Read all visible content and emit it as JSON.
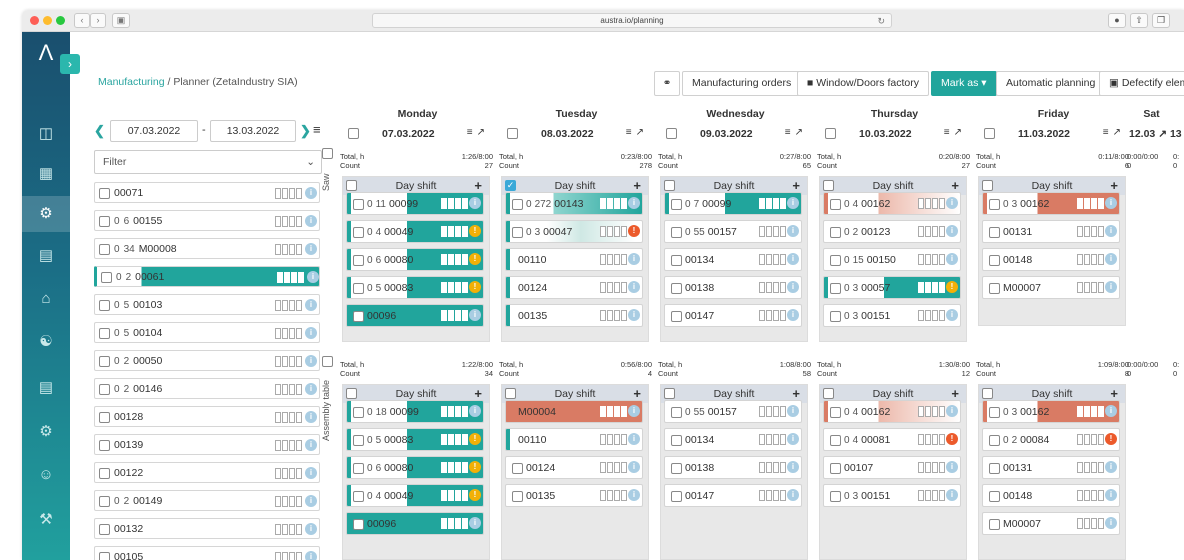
{
  "browser": {
    "url": "austra.io/planning"
  },
  "breadcrumb": {
    "root": "Manufacturing",
    "sep": "/",
    "current": "Planner (ZetaIndustry SIA)"
  },
  "toolbar": {
    "manufacturing_orders": "Manufacturing orders",
    "factory": "Window/Doors factory",
    "mark_as": "Mark as",
    "automatic_planning": "Automatic planning",
    "defectify": "Defectify eleme"
  },
  "date_range": {
    "from": "07.03.2022",
    "sep": "-",
    "to": "13.03.2022"
  },
  "filter": {
    "placeholder": "Filter"
  },
  "groups": {
    "saw": "Saw",
    "assembly": "Assembly table"
  },
  "left_list": [
    {
      "n1": "",
      "n2": "",
      "code": "00071",
      "ind": "n"
    },
    {
      "n1": "0",
      "n2": "6",
      "code": "00155",
      "ind": "n"
    },
    {
      "n1": "0",
      "n2": "34",
      "code": "M00008",
      "ind": "n"
    },
    {
      "n1": "0",
      "n2": "2",
      "code": "00061",
      "ind": "n"
    },
    {
      "n1": "0",
      "n2": "5",
      "code": "00103",
      "ind": "n"
    },
    {
      "n1": "0",
      "n2": "5",
      "code": "00104",
      "ind": "n"
    },
    {
      "n1": "0",
      "n2": "2",
      "code": "00050",
      "ind": "n"
    },
    {
      "n1": "0",
      "n2": "2",
      "code": "00146",
      "ind": "n"
    },
    {
      "n1": "",
      "n2": "",
      "code": "00128",
      "ind": "n"
    },
    {
      "n1": "",
      "n2": "",
      "code": "00139",
      "ind": "n"
    },
    {
      "n1": "",
      "n2": "",
      "code": "00122",
      "ind": "n"
    },
    {
      "n1": "0",
      "n2": "2",
      "code": "00149",
      "ind": "n"
    },
    {
      "n1": "",
      "n2": "",
      "code": "00132",
      "ind": "n"
    },
    {
      "n1": "",
      "n2": "",
      "code": "00105",
      "ind": "n"
    }
  ],
  "days": [
    {
      "name": "Monday",
      "date": "07.03.2022",
      "saw": {
        "total_label": "Total, h",
        "total": "1:26/8:00",
        "count_label": "Count",
        "count": "27"
      },
      "asm": {
        "total_label": "Total, h",
        "total": "1:22/8:00",
        "count_label": "Count",
        "count": "34"
      }
    },
    {
      "name": "Tuesday",
      "date": "08.03.2022",
      "saw": {
        "total_label": "Total, h",
        "total": "0:23/8:00",
        "count_label": "Count",
        "count": "278"
      },
      "asm": {
        "total_label": "Total, h",
        "total": "0:56/8:00",
        "count_label": "Count",
        "count": "4"
      }
    },
    {
      "name": "Wednesday",
      "date": "09.03.2022",
      "saw": {
        "total_label": "Total, h",
        "total": "0:27/8:00",
        "count_label": "Count",
        "count": "65"
      },
      "asm": {
        "total_label": "Total, h",
        "total": "1:08/8:00",
        "count_label": "Count",
        "count": "58"
      }
    },
    {
      "name": "Thursday",
      "date": "10.03.2022",
      "saw": {
        "total_label": "Total, h",
        "total": "0:20/8:00",
        "count_label": "Count",
        "count": "27"
      },
      "asm": {
        "total_label": "Total, h",
        "total": "1:30/8:00",
        "count_label": "Count",
        "count": "12"
      }
    },
    {
      "name": "Friday",
      "date": "11.03.2022",
      "saw": {
        "total_label": "Total, h",
        "total": "0:11/8:00",
        "count_label": "Count",
        "count": "6"
      },
      "asm": {
        "total_label": "Total, h",
        "total": "1:09/8:00",
        "count_label": "Count",
        "count": "8"
      }
    }
  ],
  "saturday": {
    "name": "Sat",
    "date": "12.03",
    "date2": "13",
    "saw_total": "0:00/0:00",
    "saw_short": "0:",
    "saw_count": "0",
    "saw_count2": "0",
    "asm_total": "0:00/0:00",
    "asm_short": "0:",
    "asm_count": "0",
    "asm_count2": "0"
  },
  "shift_label": "Day shift",
  "saw_cards": [
    [
      {
        "n1": "0",
        "n2": "11",
        "code": "00099",
        "style": "teal",
        "ind": "n"
      },
      {
        "n1": "0",
        "n2": "4",
        "code": "00049",
        "style": "teal",
        "ind": "warn"
      },
      {
        "n1": "0",
        "n2": "6",
        "code": "00080",
        "style": "teal",
        "ind": "warn"
      },
      {
        "n1": "0",
        "n2": "5",
        "code": "00083",
        "style": "teal",
        "ind": "warn"
      },
      {
        "n1": "",
        "n2": "",
        "code": "00096",
        "style": "tealfull",
        "ind": "n"
      }
    ],
    [
      {
        "n1": "0",
        "n2": "272",
        "code": "00143",
        "style": "tealfade",
        "ind": "n"
      },
      {
        "n1": "0",
        "n2": "3",
        "code": "00047",
        "style": "tealfade2",
        "ind": "err"
      },
      {
        "n1": "",
        "n2": "",
        "code": "00110",
        "style": "stripe",
        "ind": "n"
      },
      {
        "n1": "",
        "n2": "",
        "code": "00124",
        "style": "stripe",
        "ind": "n"
      },
      {
        "n1": "",
        "n2": "",
        "code": "00135",
        "style": "stripe",
        "ind": "n"
      }
    ],
    [
      {
        "n1": "0",
        "n2": "7",
        "code": "00099",
        "style": "teal",
        "ind": "n"
      },
      {
        "n1": "0",
        "n2": "55",
        "code": "00157",
        "style": "plain",
        "ind": "n"
      },
      {
        "n1": "",
        "n2": "",
        "code": "00134",
        "style": "plain",
        "ind": "n"
      },
      {
        "n1": "",
        "n2": "",
        "code": "00138",
        "style": "plain",
        "ind": "n"
      },
      {
        "n1": "",
        "n2": "",
        "code": "00147",
        "style": "plain",
        "ind": "n"
      }
    ],
    [
      {
        "n1": "0",
        "n2": "4",
        "code": "00162",
        "style": "redfade",
        "ind": "n"
      },
      {
        "n1": "0",
        "n2": "2",
        "code": "00123",
        "style": "plain",
        "ind": "n"
      },
      {
        "n1": "0",
        "n2": "15",
        "code": "00150",
        "style": "plain",
        "ind": "n"
      },
      {
        "n1": "0",
        "n2": "3",
        "code": "00057",
        "style": "teal",
        "ind": "warn"
      },
      {
        "n1": "0",
        "n2": "3",
        "code": "00151",
        "style": "plain",
        "ind": "n"
      }
    ],
    [
      {
        "n1": "0",
        "n2": "3",
        "code": "00162",
        "style": "red",
        "ind": "n"
      },
      {
        "n1": "",
        "n2": "",
        "code": "00131",
        "style": "plain",
        "ind": "n"
      },
      {
        "n1": "",
        "n2": "",
        "code": "00148",
        "style": "plain",
        "ind": "n"
      },
      {
        "n1": "",
        "n2": "",
        "code": "M00007",
        "style": "plain",
        "ind": "n"
      }
    ]
  ],
  "asm_cards": [
    [
      {
        "n1": "0",
        "n2": "18",
        "code": "00099",
        "style": "teal",
        "ind": "n"
      },
      {
        "n1": "0",
        "n2": "5",
        "code": "00083",
        "style": "teal",
        "ind": "warn"
      },
      {
        "n1": "0",
        "n2": "6",
        "code": "00080",
        "style": "teal",
        "ind": "warn"
      },
      {
        "n1": "0",
        "n2": "4",
        "code": "00049",
        "style": "teal",
        "ind": "warn"
      },
      {
        "n1": "",
        "n2": "",
        "code": "00096",
        "style": "tealfull",
        "ind": "n"
      }
    ],
    [
      {
        "n1": "",
        "n2": "",
        "code": "M00004",
        "style": "redfull",
        "ind": "n"
      },
      {
        "n1": "",
        "n2": "",
        "code": "00110",
        "style": "stripe",
        "ind": "n"
      },
      {
        "n1": "",
        "n2": "",
        "code": "00124",
        "style": "plain",
        "ind": "n"
      },
      {
        "n1": "",
        "n2": "",
        "code": "00135",
        "style": "plain",
        "ind": "n"
      }
    ],
    [
      {
        "n1": "0",
        "n2": "55",
        "code": "00157",
        "style": "plain",
        "ind": "n"
      },
      {
        "n1": "",
        "n2": "",
        "code": "00134",
        "style": "plain",
        "ind": "n"
      },
      {
        "n1": "",
        "n2": "",
        "code": "00138",
        "style": "plain",
        "ind": "n"
      },
      {
        "n1": "",
        "n2": "",
        "code": "00147",
        "style": "plain",
        "ind": "n"
      }
    ],
    [
      {
        "n1": "0",
        "n2": "4",
        "code": "00162",
        "style": "redfade",
        "ind": "n"
      },
      {
        "n1": "0",
        "n2": "4",
        "code": "00081",
        "style": "plain",
        "ind": "err"
      },
      {
        "n1": "",
        "n2": "",
        "code": "00107",
        "style": "plain",
        "ind": "n"
      },
      {
        "n1": "0",
        "n2": "3",
        "code": "00151",
        "style": "plain",
        "ind": "n"
      }
    ],
    [
      {
        "n1": "0",
        "n2": "3",
        "code": "00162",
        "style": "red",
        "ind": "n"
      },
      {
        "n1": "0",
        "n2": "2",
        "code": "00084",
        "style": "plain",
        "ind": "err"
      },
      {
        "n1": "",
        "n2": "",
        "code": "00131",
        "style": "plain",
        "ind": "n"
      },
      {
        "n1": "",
        "n2": "",
        "code": "00148",
        "style": "plain",
        "ind": "n"
      },
      {
        "n1": "",
        "n2": "",
        "code": "M00007",
        "style": "plain",
        "ind": "n"
      }
    ]
  ],
  "colors": {
    "teal": "#21a59c",
    "red": "#d97b64",
    "warn": "#f2b007",
    "error": "#ec5a2b"
  }
}
